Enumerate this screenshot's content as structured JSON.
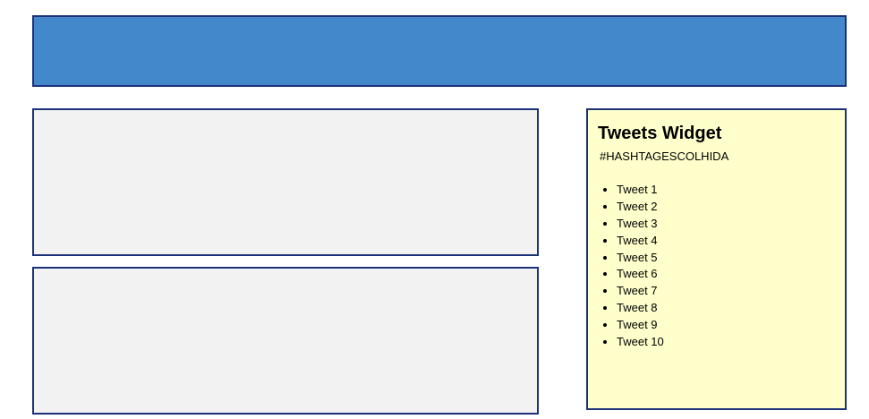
{
  "widget": {
    "title": "Tweets Widget",
    "hashtag": "#HASHTAGESCOLHIDA",
    "tweets": [
      "Tweet 1",
      "Tweet 2",
      "Tweet 3",
      "Tweet 4",
      "Tweet 5",
      "Tweet 6",
      "Tweet 7",
      "Tweet 8",
      "Tweet 9",
      "Tweet 10"
    ]
  },
  "colors": {
    "header": "#4488cc",
    "border": "#1c3278",
    "panel": "#f2f2f2",
    "widget": "#ffffcc"
  }
}
